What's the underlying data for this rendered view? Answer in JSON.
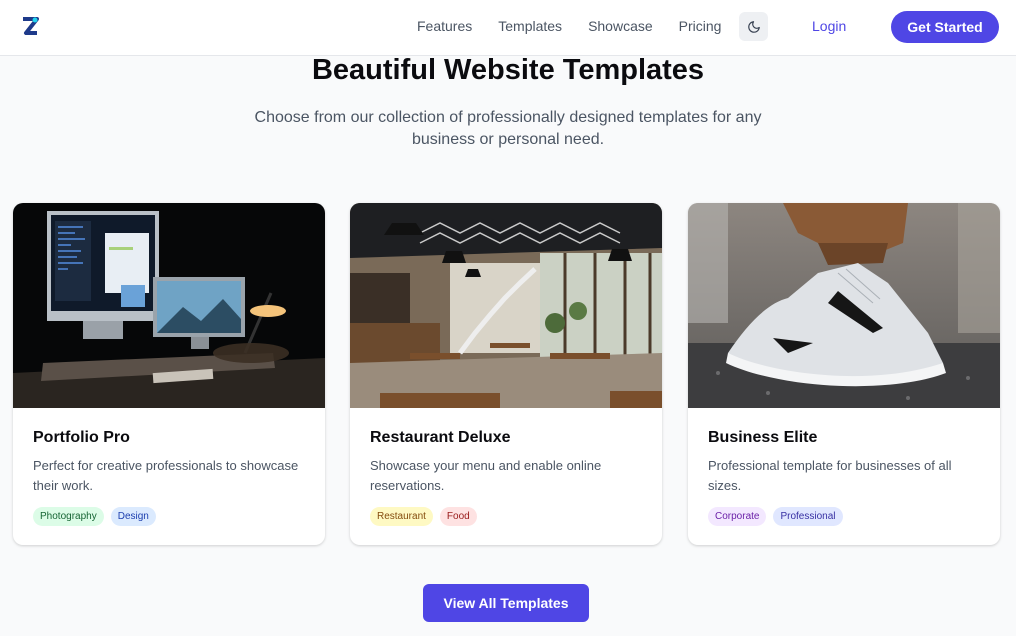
{
  "nav": {
    "links": [
      "Features",
      "Templates",
      "Showcase",
      "Pricing"
    ],
    "login": "Login",
    "cta": "Get Started"
  },
  "hero": {
    "title": "Beautiful Website Templates",
    "subtitle": "Choose from our collection of professionally designed templates for any business or personal need."
  },
  "cards": [
    {
      "title": "Portfolio Pro",
      "description": "Perfect for creative professionals to showcase their work.",
      "image": "desk-computer-night-photo",
      "tags": [
        {
          "label": "Photography",
          "bg": "#dcfce7",
          "fg": "#166534"
        },
        {
          "label": "Design",
          "bg": "#dbeafe",
          "fg": "#1e40af"
        }
      ]
    },
    {
      "title": "Restaurant Deluxe",
      "description": "Showcase your menu and enable online reservations.",
      "image": "restaurant-interior-photo",
      "tags": [
        {
          "label": "Restaurant",
          "bg": "#fef9c3",
          "fg": "#854d0e"
        },
        {
          "label": "Food",
          "bg": "#fee2e2",
          "fg": "#991b1b"
        }
      ]
    },
    {
      "title": "Business Elite",
      "description": "Professional template for businesses of all sizes.",
      "image": "sneaker-photo",
      "tags": [
        {
          "label": "Corporate",
          "bg": "#f3e8ff",
          "fg": "#6b21a8"
        },
        {
          "label": "Professional",
          "bg": "#e0e7ff",
          "fg": "#3730a3"
        }
      ]
    }
  ],
  "footer_cta": "View All Templates",
  "colors": {
    "brand": "#4f46e5",
    "background": "#f9fafb"
  }
}
